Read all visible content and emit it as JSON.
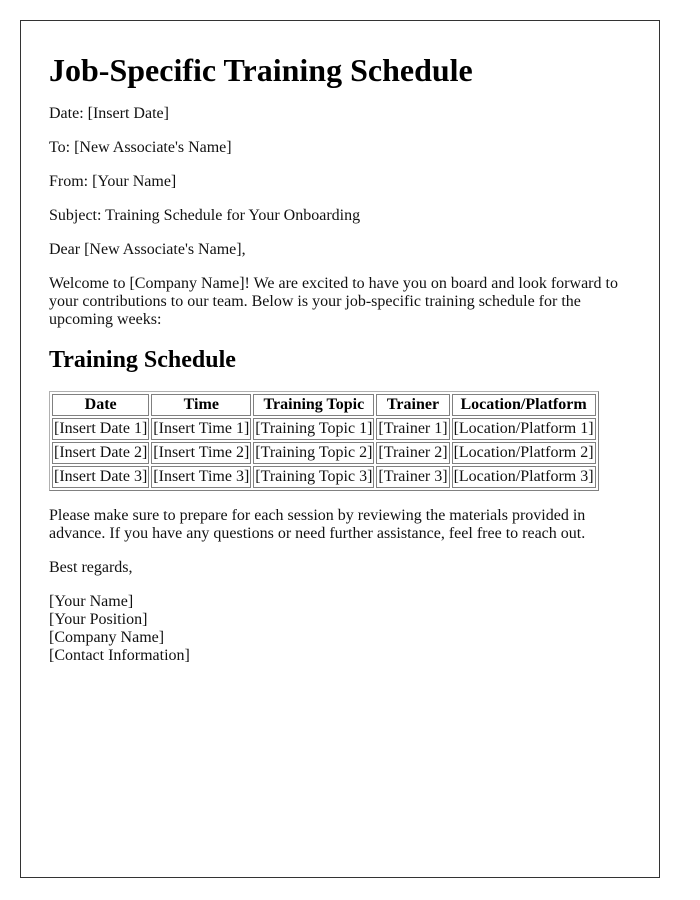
{
  "document": {
    "title": "Job-Specific Training Schedule",
    "meta": {
      "date": "Date: [Insert Date]",
      "to": "To: [New Associate's Name]",
      "from": "From: [Your Name]",
      "subject": "Subject: Training Schedule for Your Onboarding"
    },
    "salutation": "Dear [New Associate's Name],",
    "intro": "Welcome to [Company Name]! We are excited to have you on board and look forward to your contributions to our team. Below is your job-specific training schedule for the upcoming weeks:",
    "section_heading": "Training Schedule",
    "table": {
      "headers": [
        "Date",
        "Time",
        "Training Topic",
        "Trainer",
        "Location/Platform"
      ],
      "rows": [
        [
          "[Insert Date 1]",
          "[Insert Time 1]",
          "[Training Topic 1]",
          "[Trainer 1]",
          "[Location/Platform 1]"
        ],
        [
          "[Insert Date 2]",
          "[Insert Time 2]",
          "[Training Topic 2]",
          "[Trainer 2]",
          "[Location/Platform 2]"
        ],
        [
          "[Insert Date 3]",
          "[Insert Time 3]",
          "[Training Topic 3]",
          "[Trainer 3]",
          "[Location/Platform 3]"
        ]
      ]
    },
    "closing": "Please make sure to prepare for each session by reviewing the materials provided in advance. If you have any questions or need further assistance, feel free to reach out.",
    "signoff": "Best regards,",
    "signature": {
      "name": "[Your Name]",
      "position": "[Your Position]",
      "company": "[Company Name]",
      "contact": "[Contact Information]"
    }
  }
}
